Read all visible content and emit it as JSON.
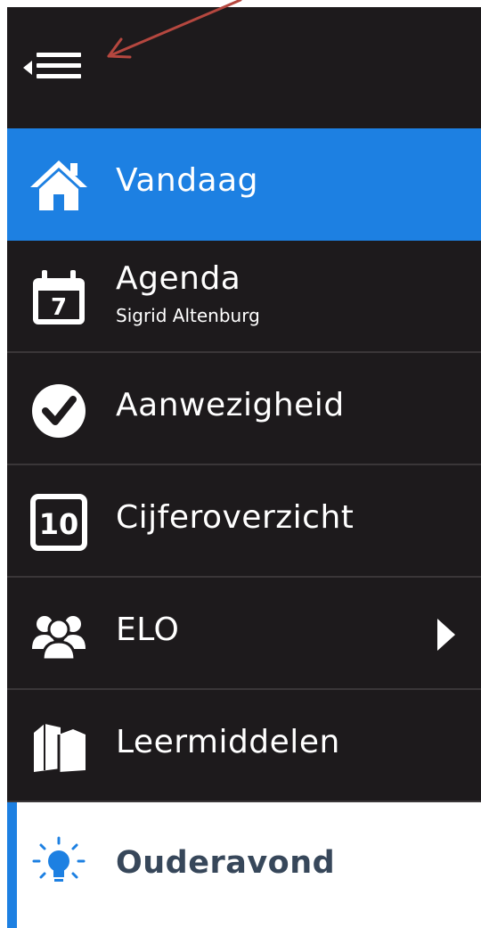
{
  "colors": {
    "background": "#1d1a1c",
    "active": "#1d80e2",
    "text": "#ffffff",
    "highlight_text": "#37475a",
    "annotation_arrow": "#b5473f"
  },
  "header": {
    "toggle_icon": "menu-collapse-icon"
  },
  "menu": {
    "items": [
      {
        "label": "Vandaag",
        "icon": "home-icon",
        "state": "active"
      },
      {
        "label": "Agenda",
        "sublabel": "Sigrid Altenburg",
        "icon": "calendar-icon",
        "icon_text": "7"
      },
      {
        "label": "Aanwezigheid",
        "icon": "check-circle-icon"
      },
      {
        "label": "Cijferoverzicht",
        "icon": "grade-icon",
        "icon_text": "10"
      },
      {
        "label": "ELO",
        "icon": "users-icon",
        "has_submenu": true
      },
      {
        "label": "Leermiddelen",
        "icon": "books-icon"
      },
      {
        "label": "Ouderavond",
        "icon": "lightbulb-icon",
        "state": "highlighted"
      }
    ]
  }
}
